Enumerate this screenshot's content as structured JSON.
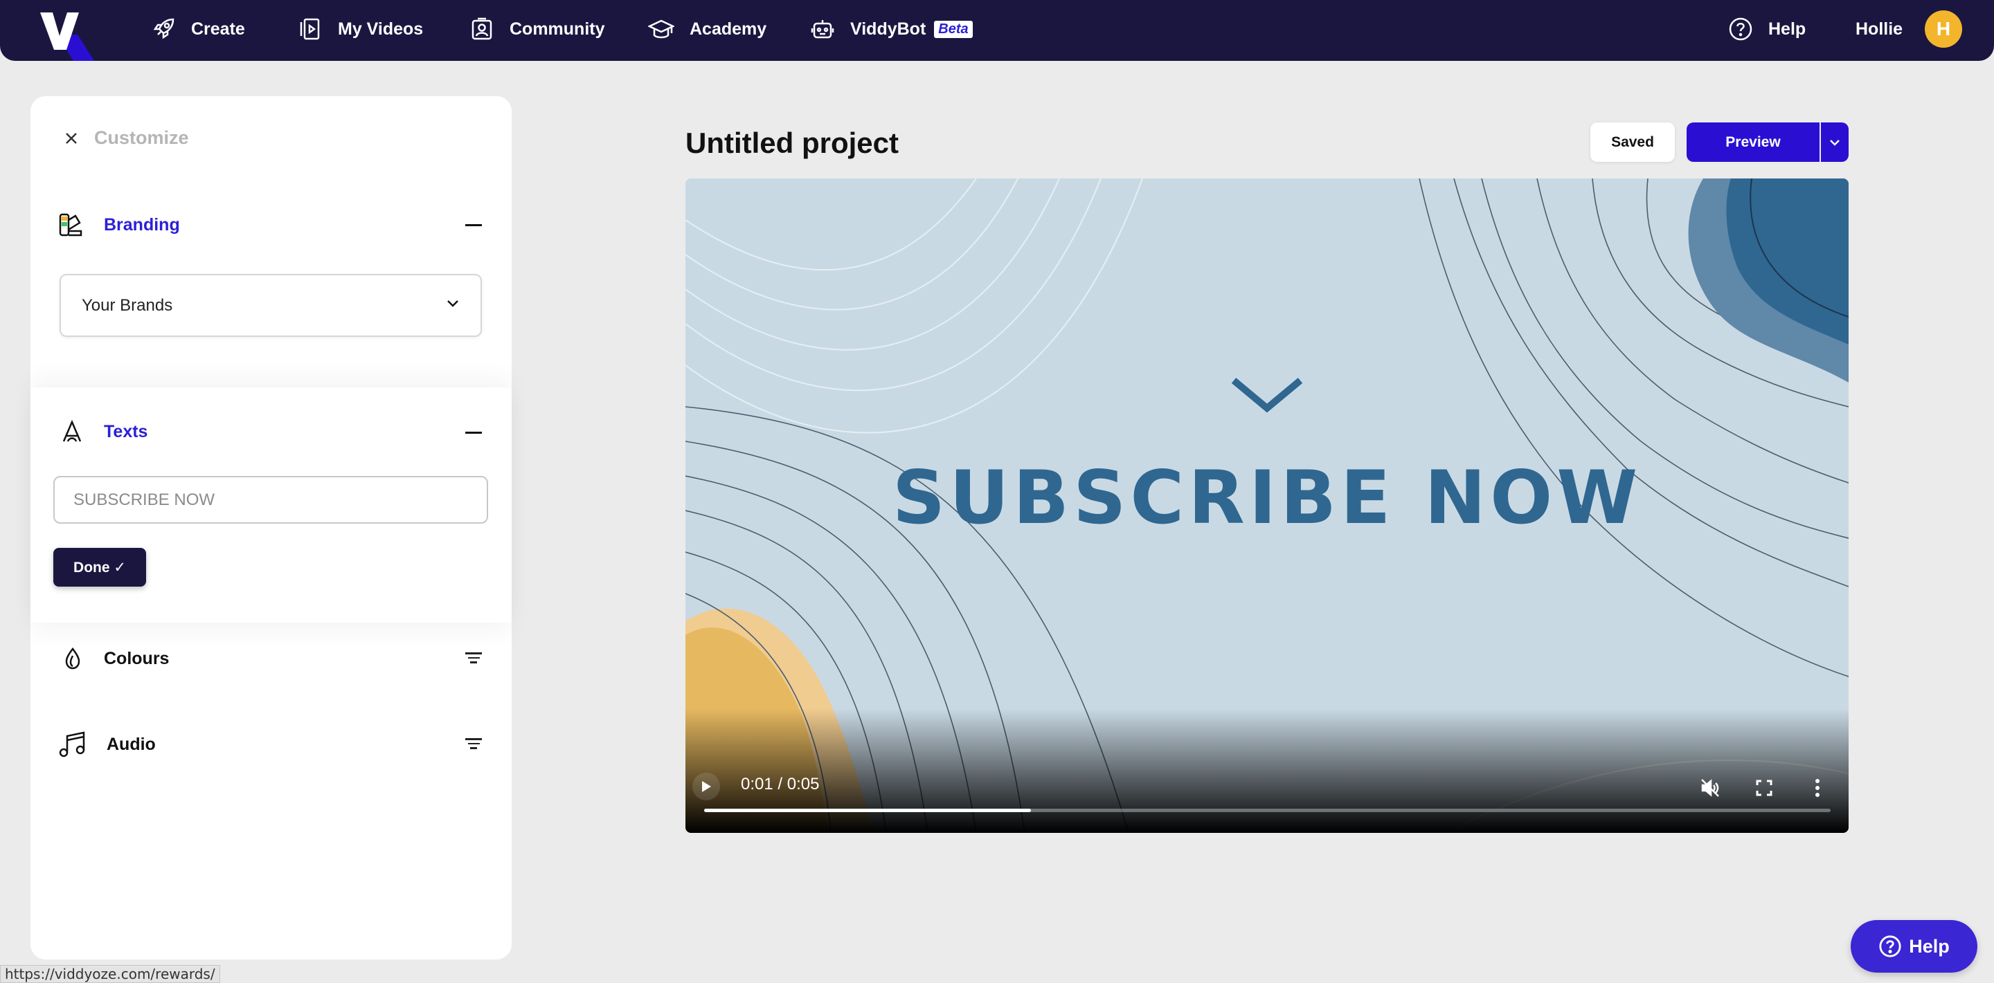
{
  "nav": {
    "items": [
      {
        "label": "Create",
        "icon": "rocket-icon"
      },
      {
        "label": "My Videos",
        "icon": "videos-icon"
      },
      {
        "label": "Community",
        "icon": "community-icon"
      },
      {
        "label": "Academy",
        "icon": "graduation-cap-icon"
      },
      {
        "label": "ViddyBot",
        "icon": "robot-icon",
        "badge": "Beta"
      }
    ],
    "help_label": "Help",
    "user_name": "Hollie",
    "avatar_initial": "H"
  },
  "panel": {
    "title": "Customize",
    "branding": {
      "label": "Branding",
      "select_value": "Your Brands"
    },
    "texts": {
      "label": "Texts",
      "input_value": "SUBSCRIBE NOW",
      "done_label": "Done ✓"
    },
    "colours": {
      "label": "Colours"
    },
    "audio": {
      "label": "Audio"
    }
  },
  "main": {
    "project_title": "Untitled project",
    "saved_label": "Saved",
    "preview_label": "Preview"
  },
  "video": {
    "headline": "SUBSCRIBE NOW",
    "time": "0:01 / 0:05",
    "progress": 0.29
  },
  "status_url": "https://viddyoze.com/rewards/",
  "help_fab": "Help",
  "colors": {
    "nav_bg": "#1b1640",
    "accent": "#2c1fd6",
    "avatar": "#f3b52c",
    "video_bg": "#c9d9e4"
  }
}
